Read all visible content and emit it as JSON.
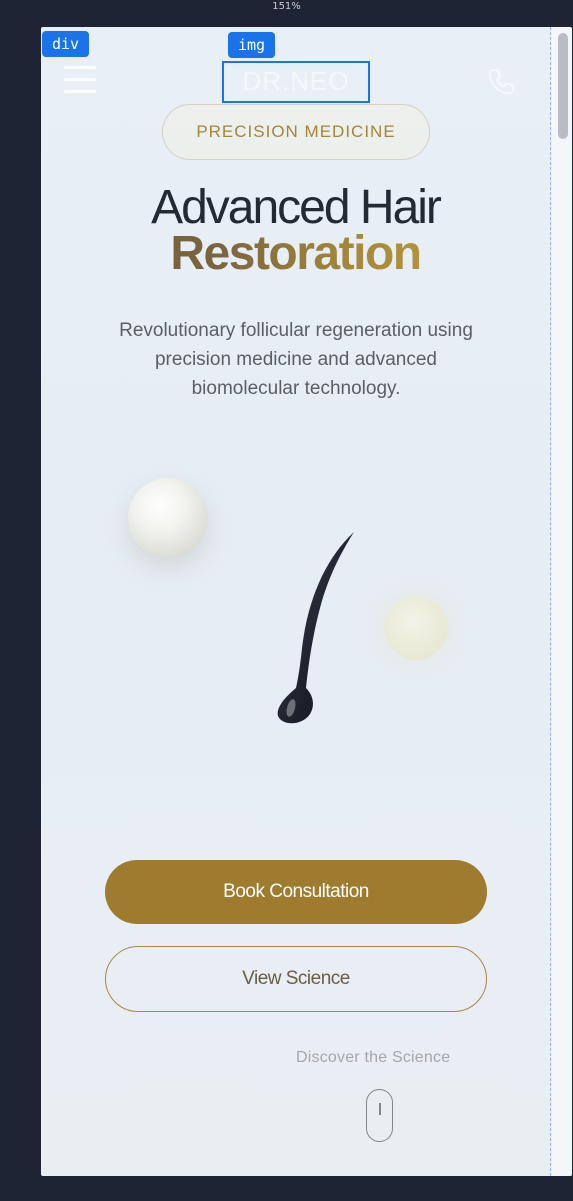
{
  "devtools": {
    "zoom_label": "151%",
    "tag_div": "div",
    "tag_img": "img"
  },
  "header": {
    "logo_text": "DR.NEO",
    "menu_icon": "hamburger-menu-icon",
    "phone_icon": "phone-icon"
  },
  "hero": {
    "badge": "PRECISION MEDICINE",
    "headline_line1": "Advanced Hair",
    "headline_line2": "Restoration",
    "subtitle": "Revolutionary follicular regeneration using precision medicine and advanced biomolecular technology."
  },
  "actions": {
    "primary_label": "Book Consultation",
    "secondary_label": "View Science"
  },
  "scroll_hint": {
    "label": "Discover the Science",
    "icon": "scroll-mouse-icon"
  },
  "colors": {
    "accent_gold": "#9e7b2e",
    "page_bg": "#1e2433",
    "frame_bg": "#e8eff6",
    "debug_blue": "#1a73e8"
  }
}
